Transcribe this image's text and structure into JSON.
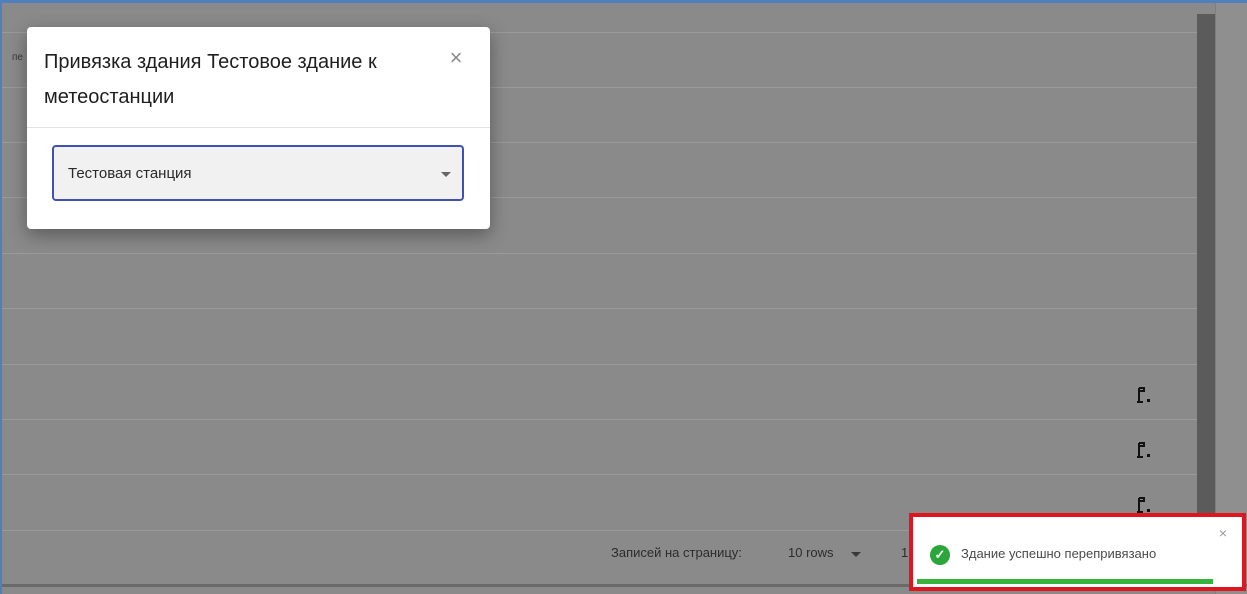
{
  "background": {
    "edge_text": "пе",
    "footer": {
      "rows_per_page_label": "Записей на страницу:",
      "rows_value": "10 rows",
      "page_indicator": "1"
    },
    "row_icon": "flag-icon"
  },
  "dialog": {
    "title": "Привязка здания Тестовое здание к метеостанции",
    "close_glyph": "×",
    "select": {
      "value": "Тестовая станция",
      "icon": "chevron-down-icon"
    }
  },
  "toast": {
    "message": "Здание успешно перепривязано",
    "status_icon": "check-circle-icon",
    "close_glyph": "×",
    "progress": 0.9,
    "colors": {
      "highlight": "#e0161e",
      "success": "#2aa63a"
    }
  },
  "colors": {
    "overlay": "#8a8a8a",
    "accent": "#3f51b5"
  }
}
